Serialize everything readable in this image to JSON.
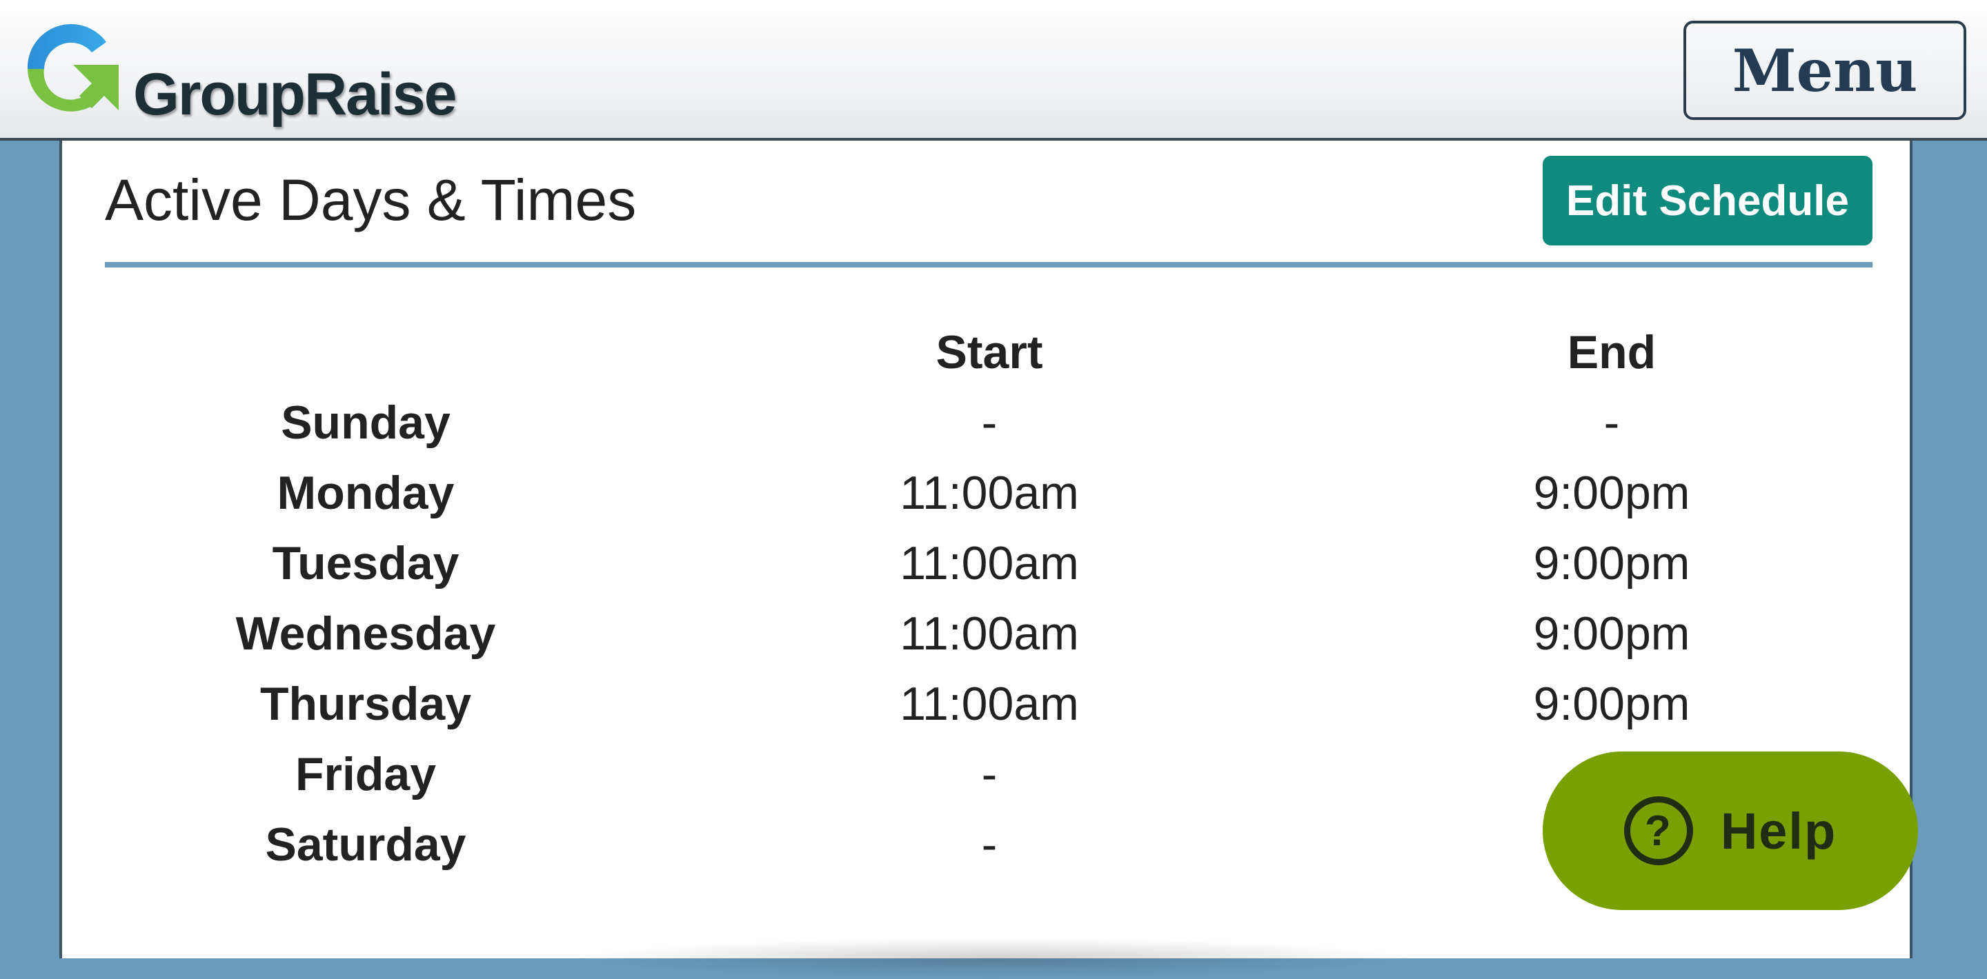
{
  "header": {
    "logo_text": "GroupRaise",
    "menu_label": "Menu"
  },
  "section": {
    "title": "Active Days & Times",
    "edit_label": "Edit Schedule"
  },
  "schedule": {
    "columns": {
      "start": "Start",
      "end": "End"
    },
    "rows": [
      {
        "day": "Sunday",
        "start": "-",
        "end": "-"
      },
      {
        "day": "Monday",
        "start": "11:00am",
        "end": "9:00pm"
      },
      {
        "day": "Tuesday",
        "start": "11:00am",
        "end": "9:00pm"
      },
      {
        "day": "Wednesday",
        "start": "11:00am",
        "end": "9:00pm"
      },
      {
        "day": "Thursday",
        "start": "11:00am",
        "end": "9:00pm"
      },
      {
        "day": "Friday",
        "start": "-",
        "end": ""
      },
      {
        "day": "Saturday",
        "start": "-",
        "end": ""
      }
    ]
  },
  "help": {
    "label": "Help",
    "icon": "question-circle-icon"
  },
  "colors": {
    "brand_green": "#7ac143",
    "brand_blue": "#2b8fd6",
    "accent_teal": "#0f8a7f",
    "help_green": "#78a000",
    "side_blue": "#6a9bbd"
  }
}
